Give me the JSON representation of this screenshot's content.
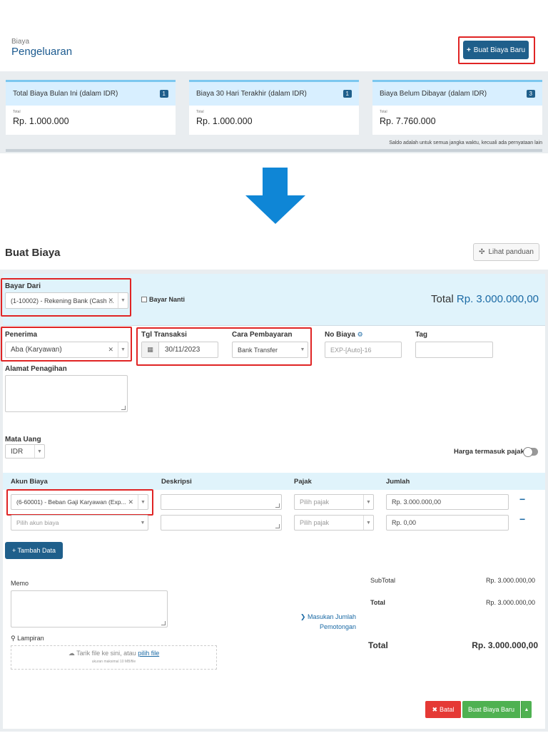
{
  "top": {
    "breadcrumb": "Biaya",
    "title": "Pengeluaran",
    "new_button": "Buat Biaya Baru",
    "cards": [
      {
        "title": "Total Biaya Bulan Ini (dalam IDR)",
        "badge": "1",
        "total_label": "Total",
        "value": "Rp. 1.000.000"
      },
      {
        "title": "Biaya 30 Hari Terakhir (dalam IDR)",
        "badge": "1",
        "total_label": "Total",
        "value": "Rp. 1.000.000"
      },
      {
        "title": "Biaya Belum Dibayar (dalam IDR)",
        "badge": "3",
        "total_label": "Total",
        "value": "Rp. 7.760.000"
      }
    ],
    "saldo_note": "Saldo adalah untuk semua jangka waktu, kecuali ada pernyataan lain"
  },
  "form": {
    "title": "Buat Biaya",
    "guide_button": "Lihat panduan",
    "bayar_dari": {
      "label": "Bayar Dari",
      "value": "(1-10002) - Rekening Bank (Cash ..."
    },
    "bayar_nanti": "Bayar Nanti",
    "total_label": "Total",
    "total_value": "Rp. 3.000.000,00",
    "penerima": {
      "label": "Penerima",
      "value": "Aba (Karyawan)"
    },
    "tgl_transaksi": {
      "label": "Tgl Transaksi",
      "value": "30/11/2023"
    },
    "cara_pembayaran": {
      "label": "Cara Pembayaran",
      "value": "Bank Transfer"
    },
    "no_biaya": {
      "label": "No Biaya",
      "placeholder": "EXP-[Auto]-16"
    },
    "tag": {
      "label": "Tag"
    },
    "alamat": {
      "label": "Alamat Penagihan"
    },
    "mata_uang": {
      "label": "Mata Uang",
      "value": "IDR"
    },
    "harga_pajak": "Harga termasuk pajak",
    "table": {
      "headers": [
        "Akun Biaya",
        "Deskripsi",
        "Pajak",
        "Jumlah"
      ],
      "rows": [
        {
          "akun": "(6-60001) - Beban Gaji Karyawan (Exp...",
          "pajak_placeholder": "Pilih pajak",
          "jumlah": "Rp. 3.000.000,00"
        },
        {
          "akun_placeholder": "Pilih akun biaya",
          "pajak_placeholder": "Pilih pajak",
          "jumlah": "Rp. 0,00"
        }
      ]
    },
    "tambah_button": "+ Tambah Data",
    "memo": "Memo",
    "lampiran": "Lampiran",
    "upload_text": "Tarik file ke sini, atau",
    "upload_link": "pilih file",
    "upload_limit": "ukuran maksimal 10 MB/file",
    "potongan_link_1": "Masukan Jumlah",
    "potongan_link_2": "Pemotongan",
    "subtotal_label": "SubTotal",
    "subtotal_value": "Rp. 3.000.000,00",
    "total2_label": "Total",
    "total2_value": "Rp. 3.000.000,00",
    "grand_total_label": "Total",
    "grand_total_value": "Rp. 3.000.000,00",
    "batal_button": "Batal",
    "create_button": "Buat Biaya Baru"
  },
  "colors": {
    "accent": "#1f5f8b",
    "arrow": "#0f86d6",
    "highlight": "#e02424",
    "success": "#4fb151",
    "danger": "#e53935"
  }
}
